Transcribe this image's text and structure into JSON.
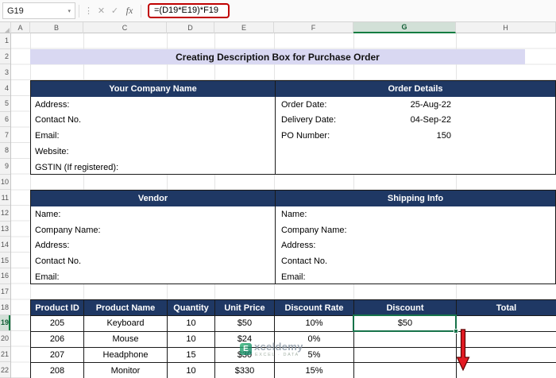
{
  "formula_bar": {
    "name_box": "G19",
    "formula": "=(D19*E19)*F19"
  },
  "icons": {
    "chevron_down": "▾",
    "more": "⋮",
    "cancel": "✕",
    "check": "✓",
    "fx": "fx"
  },
  "columns": [
    "A",
    "B",
    "C",
    "D",
    "E",
    "F",
    "G",
    "H"
  ],
  "rows": [
    "1",
    "2",
    "3",
    "4",
    "5",
    "6",
    "7",
    "8",
    "9",
    "10",
    "11",
    "12",
    "13",
    "14",
    "15",
    "16",
    "17",
    "18",
    "19",
    "20",
    "21",
    "22"
  ],
  "selection": {
    "cell": "G19",
    "column": "G",
    "row": "19",
    "value": "$50"
  },
  "title": "Creating Description Box for Purchase Order",
  "company": {
    "header": "Your Company Name",
    "labels": [
      "Address:",
      "Contact No.",
      "Email:",
      "Website:",
      "GSTIN (If registered):"
    ]
  },
  "order_details": {
    "header": "Order Details",
    "rows": [
      {
        "label": "Order Date:",
        "value": "25-Aug-22"
      },
      {
        "label": "Delivery Date:",
        "value": "04-Sep-22"
      },
      {
        "label": "PO Number:",
        "value": "150"
      }
    ]
  },
  "vendor": {
    "header": "Vendor",
    "labels": [
      "Name:",
      "Company Name:",
      "Address:",
      "Contact No.",
      "Email:"
    ]
  },
  "shipping": {
    "header": "Shipping Info",
    "labels": [
      "Name:",
      "Company Name:",
      "Address:",
      "Contact No.",
      "Email:"
    ]
  },
  "product_table": {
    "headers": [
      "Product ID",
      "Product Name",
      "Quantity",
      "Unit Price",
      "Discount Rate",
      "Discount",
      "Total"
    ],
    "rows": [
      [
        "205",
        "Keyboard",
        "10",
        "$50",
        "10%",
        "$50",
        ""
      ],
      [
        "206",
        "Mouse",
        "10",
        "$24",
        "0%",
        "",
        ""
      ],
      [
        "207",
        "Headphone",
        "15",
        "$30",
        "5%",
        "",
        ""
      ],
      [
        "208",
        "Monitor",
        "10",
        "$330",
        "15%",
        "",
        ""
      ]
    ]
  },
  "watermark": {
    "brand_initial": "E",
    "brand_rest": "xceldemy",
    "tagline": "EXCEL · DATA"
  },
  "colors": {
    "header_navy": "#1F3864",
    "title_bg": "#D9D8F2",
    "selection_green": "#17734A",
    "formula_highlight_red": "#C00000",
    "arrow_red": "#E31B23"
  }
}
